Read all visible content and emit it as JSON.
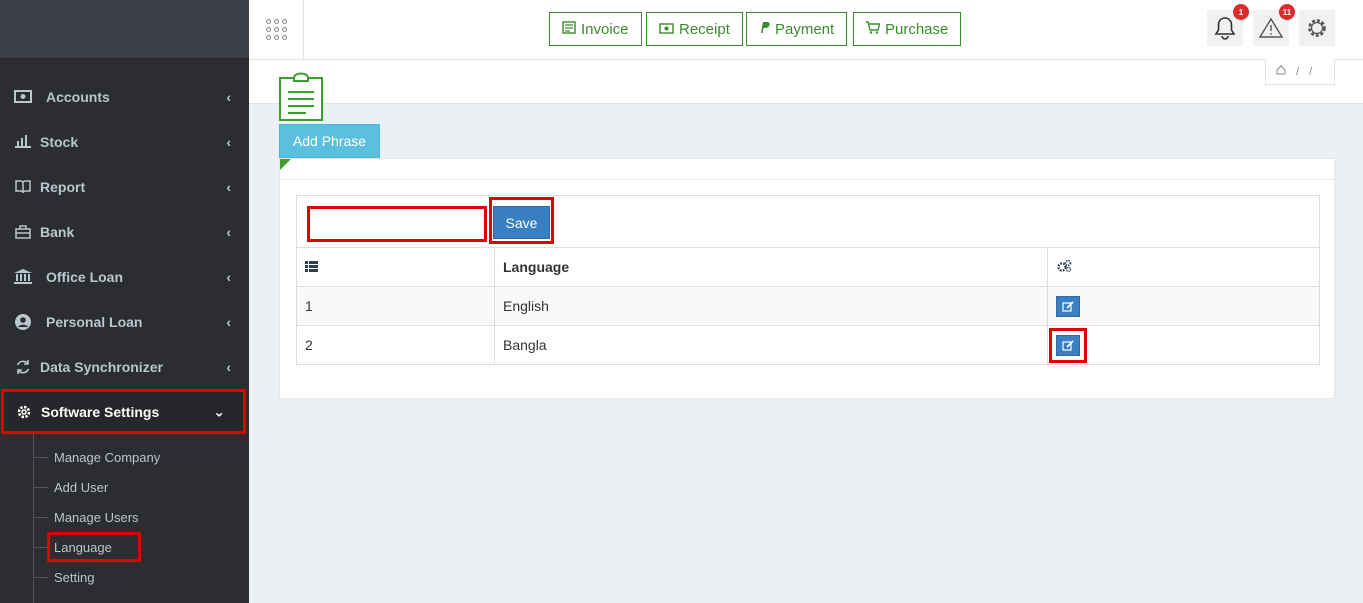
{
  "sidebar": {
    "items": [
      {
        "label": "Accounts",
        "icon": "money-icon"
      },
      {
        "label": "Stock",
        "icon": "bar-chart-icon"
      },
      {
        "label": "Report",
        "icon": "book-icon"
      },
      {
        "label": "Bank",
        "icon": "briefcase-icon"
      },
      {
        "label": "Office Loan",
        "icon": "bank-icon"
      },
      {
        "label": "Personal Loan",
        "icon": "user-circle-icon"
      },
      {
        "label": "Data Synchronizer",
        "icon": "refresh-icon"
      },
      {
        "label": "Software Settings",
        "icon": "gear-icon"
      }
    ],
    "submenu": [
      "Manage Company",
      "Add User",
      "Manage Users",
      "Language",
      "Setting"
    ]
  },
  "topbar": {
    "quick_actions": [
      "Invoice",
      "Receipt",
      "Payment",
      "Purchase"
    ],
    "notifications_count": "1",
    "alerts_count": "11"
  },
  "breadcrumb": {
    "sep1": "/",
    "sep2": "/"
  },
  "page": {
    "add_phrase_label": "Add Phrase",
    "phrase_input_value": "",
    "save_label": "Save"
  },
  "table": {
    "header_language": "Language",
    "rows": [
      {
        "num": "1",
        "language": "English"
      },
      {
        "num": "2",
        "language": "Bangla"
      }
    ]
  },
  "colors": {
    "accent_green": "#3a8d2c",
    "info": "#5bc0de",
    "primary": "#3a7fc1",
    "highlight": "#e00000",
    "sidebar_bg": "#2b2d30"
  }
}
